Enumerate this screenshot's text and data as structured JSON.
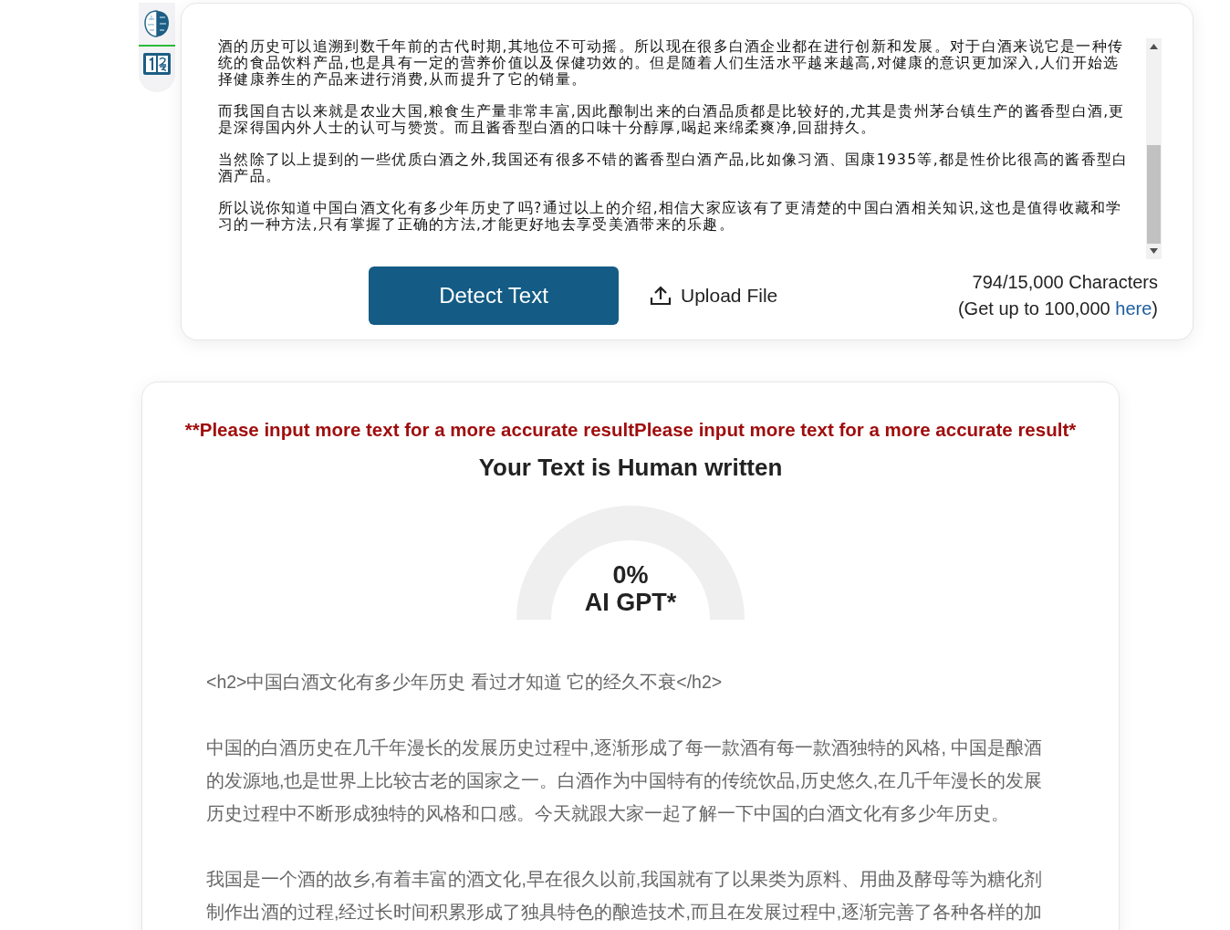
{
  "sidebar": {
    "items": [
      {
        "kind": "brain",
        "selected": true
      },
      {
        "kind": "numbers",
        "selected": false
      }
    ]
  },
  "input": {
    "paragraphs": [
      "酒的历史可以追溯到数千年前的古代时期,其地位不可动摇。所以现在很多白酒企业都在进行创新和发展。对于白酒来说它是一种传统的食品饮料产品,也是具有一定的营养价值以及保健功效的。但是随着人们生活水平越来越高,对健康的意识更加深入,人们开始选择健康养生的产品来进行消费,从而提升了它的销量。",
      "而我国自古以来就是农业大国,粮食生产量非常丰富,因此酿制出来的白酒品质都是比较好的,尤其是贵州茅台镇生产的酱香型白酒,更是深得国内外人士的认可与赞赏。而且酱香型白酒的口味十分醇厚,喝起来绵柔爽净,回甜持久。",
      "当然除了以上提到的一些优质白酒之外,我国还有很多不错的酱香型白酒产品,比如像习酒、国康1935等,都是性价比很高的酱香型白酒产品。",
      "所以说你知道中国白酒文化有多少年历史了吗?通过以上的介绍,相信大家应该有了更清楚的中国白酒相关知识,这也是值得收藏和学习的一种方法,只有掌握了正确的方法,才能更好地去享受美酒带来的乐趣。"
    ]
  },
  "detect_button": "Detect Text",
  "upload_button": "Upload File",
  "char_count": "794/15,000 Characters",
  "upgrade_note": {
    "before": "(Get up to 100,000 ",
    "link": "here",
    "after": ")"
  },
  "result": {
    "warning": "**Please input more text for a more accurate resultPlease input more text for a more accurate result*",
    "verdict": "Your Text is Human written",
    "gauge": {
      "percent": "0%",
      "label": "AI GPT*"
    },
    "paragraphs": [
      "<h2>中国白酒文化有多少年历史 看过才知道 它的经久不衰</h2>",
      "中国的白酒历史在几千年漫长的发展历史过程中,逐渐形成了每一款酒有每一款酒独特的风格, 中国是酿酒的发源地,也是世界上比较古老的国家之一。白酒作为中国特有的传统饮品,历史悠久,在几千年漫长的发展历史过程中不断形成独特的风格和口感。今天就跟大家一起了解一下中国的白酒文化有多少年历史。",
      "我国是一个酒的故乡,有着丰富的酒文化,早在很久以前,我国就有了以果类为原料、用曲及酵母等为糖化剂制作出酒的过程,经过长时间积累形成了独具特色的酿造技术,而且在发展过程中,逐渐完善了各种各样的加"
    ]
  }
}
